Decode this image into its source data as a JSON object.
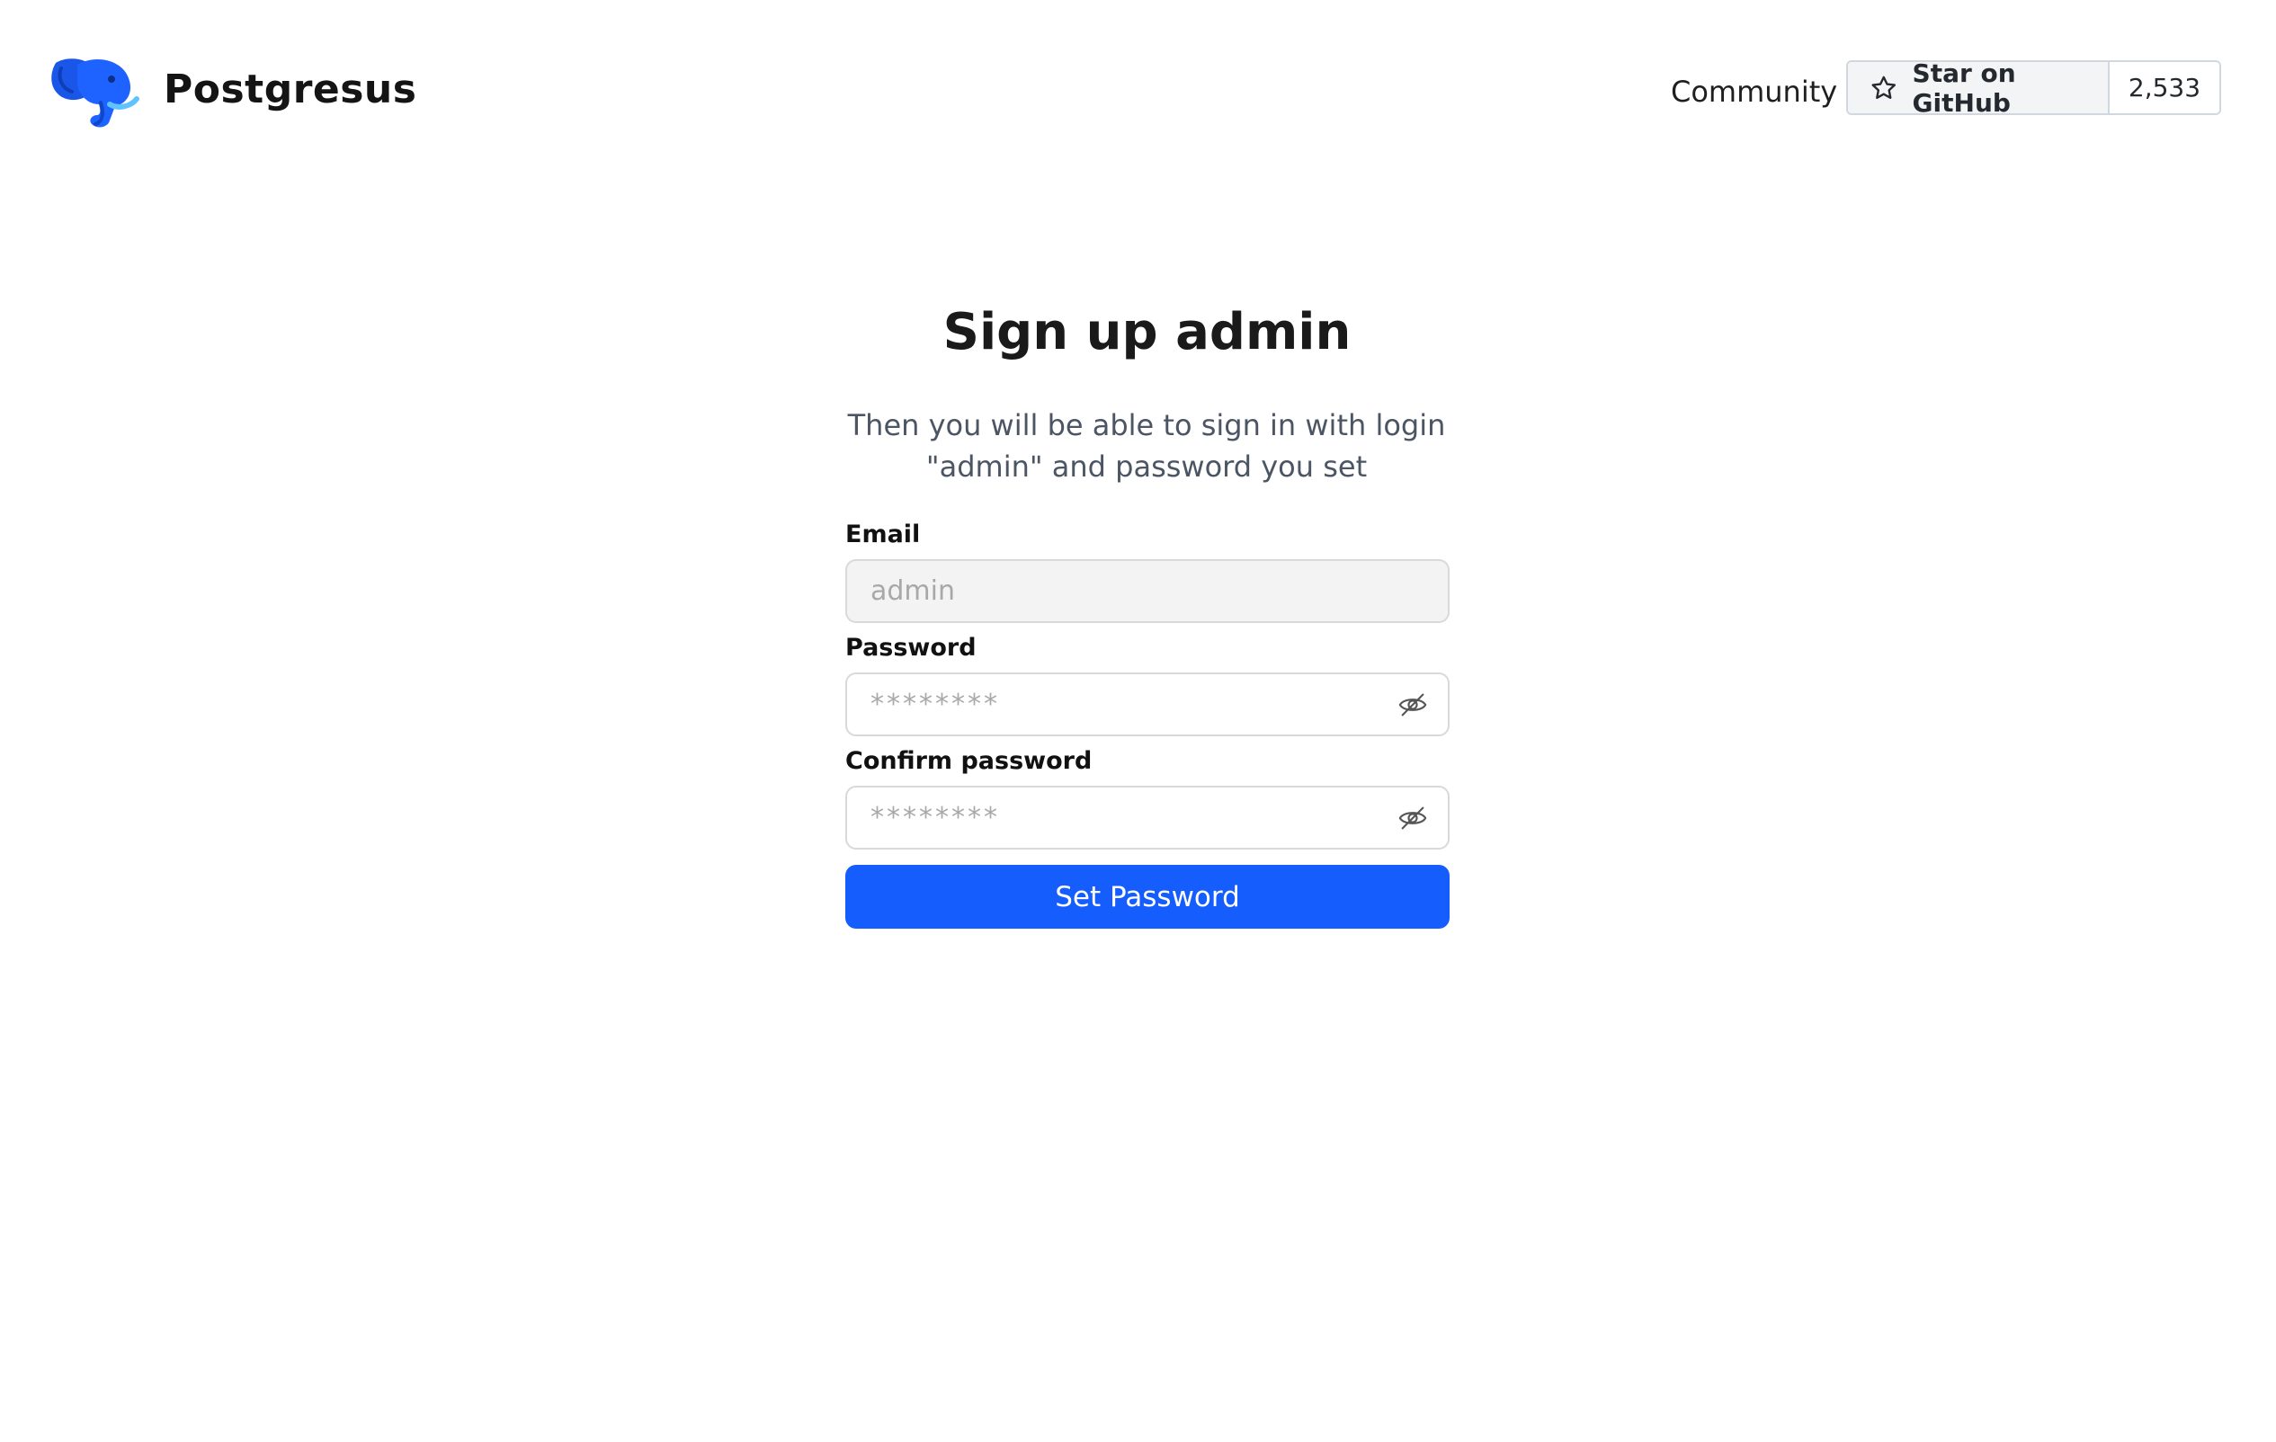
{
  "header": {
    "brand_name": "Postgresus",
    "logo_icon": "elephant-logo-icon",
    "community_label": "Community",
    "github": {
      "star_label": "Star on GitHub",
      "star_count": "2,533",
      "star_icon": "star-icon"
    }
  },
  "form": {
    "title": "Sign up admin",
    "subtitle": "Then you will be able to sign in with login \"admin\" and password you set",
    "email": {
      "label": "Email",
      "value": "admin"
    },
    "password": {
      "label": "Password",
      "placeholder": "********",
      "toggle_icon": "eye-off-icon"
    },
    "confirm_password": {
      "label": "Confirm password",
      "placeholder": "********",
      "toggle_icon": "eye-off-icon"
    },
    "submit_label": "Set Password"
  },
  "colors": {
    "primary": "#155dfc",
    "logo_blue": "#1e5ef5",
    "border": "#d9d9d9",
    "disabled_bg": "#f3f3f3"
  }
}
